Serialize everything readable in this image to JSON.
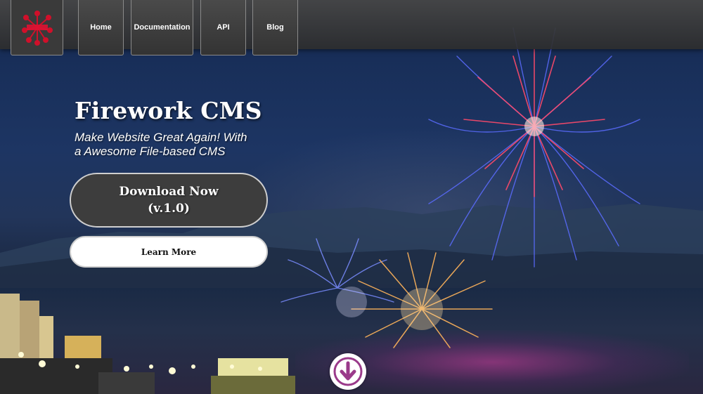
{
  "nav": {
    "logo_icon": "firework-logo-icon",
    "items": [
      {
        "label": "Home"
      },
      {
        "label": "Documentation"
      },
      {
        "label": "API"
      },
      {
        "label": "Blog"
      }
    ]
  },
  "hero": {
    "title": "Firework CMS",
    "subtitle_line1": "Make Website Great Again! With",
    "subtitle_line2": "a Awesome File-based CMS",
    "download_line1": "Download Now",
    "download_line2": "(v.1.0)",
    "learn_more": "Learn More",
    "scroll_icon": "arrow-down-circle-icon"
  },
  "colors": {
    "nav_bg": "#3a3a3a",
    "button_dark": "#3d3d3d",
    "button_light": "#ffffff",
    "text": "#ffffff"
  }
}
